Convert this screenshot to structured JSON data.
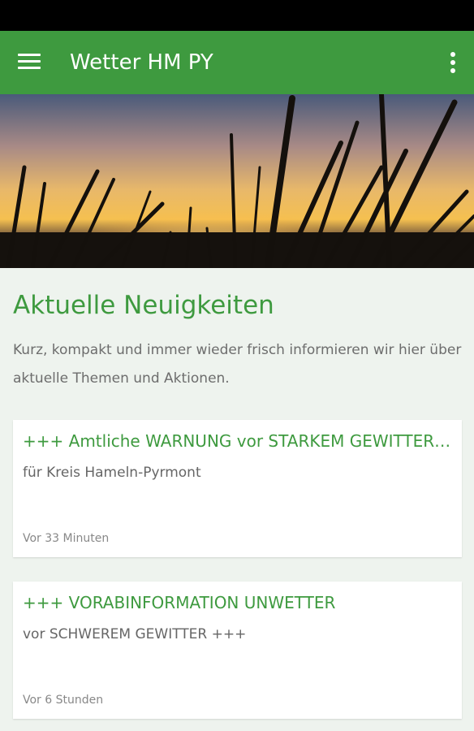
{
  "app_bar": {
    "title": "Wetter HM PY",
    "menu_icon": "hamburger-menu-icon",
    "overflow_icon": "more-vert-icon",
    "color": "#3e9a3f"
  },
  "hero": {
    "image": "sunset-grass-image"
  },
  "news": {
    "heading": "Aktuelle Neuigkeiten",
    "intro": "Kurz, kompakt und immer wieder frisch informieren wir hier über aktuelle Themen und Aktionen.",
    "items": [
      {
        "title": "+++ Amtliche WARNUNG vor STARKEM GEWITTER +++",
        "subtitle": "für Kreis Hameln-Pyrmont",
        "time": "Vor 33 Minuten"
      },
      {
        "title": "+++ VORABINFORMATION UNWETTER",
        "subtitle": "vor SCHWEREM GEWITTER +++",
        "time": "Vor 6 Stunden"
      }
    ]
  },
  "colors": {
    "accent": "#3e9a3f",
    "background": "#eef3ee",
    "text_secondary": "#6d6d6d"
  }
}
